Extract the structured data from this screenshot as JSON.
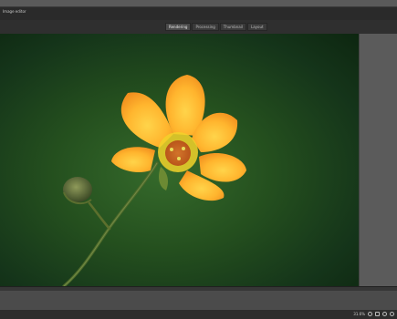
{
  "app": {
    "title": "Image editor"
  },
  "toolbar": {
    "tabs": [
      {
        "label": "Rendering"
      },
      {
        "label": "Processing"
      },
      {
        "label": "Thumbnail"
      },
      {
        "label": "Layout"
      }
    ]
  },
  "status": {
    "zoom": "31.6%"
  },
  "icons": {
    "status_btn_1": "refresh-icon",
    "status_btn_2": "fit-icon",
    "status_btn_3": "fullscreen-icon",
    "status_btn_4": "settings-icon"
  }
}
